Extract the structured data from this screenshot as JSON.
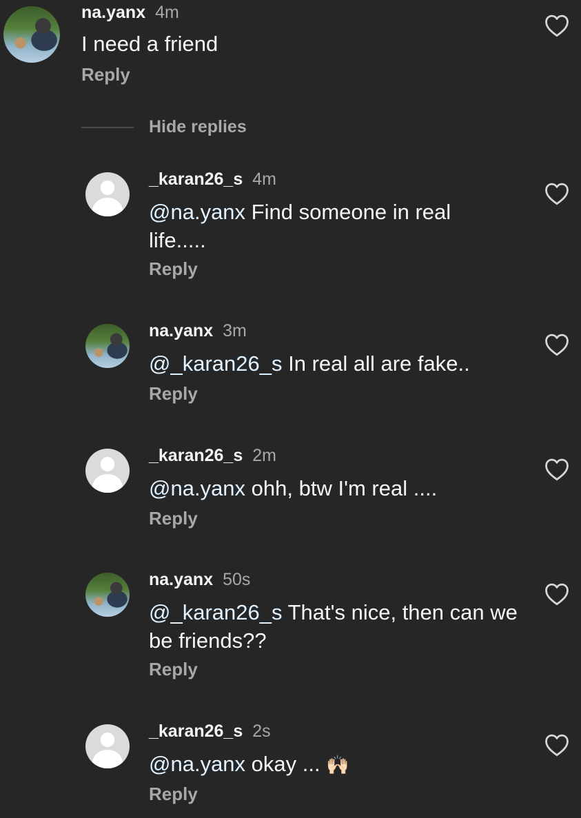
{
  "comments": [
    {
      "username": "na.yanx",
      "time": "4m",
      "mention": "",
      "text": "I need a friend",
      "reply": "Reply",
      "avatar": "photo"
    },
    {
      "username": "_karan26_s",
      "time": "4m",
      "mention": "@na.yanx",
      "text": " Find someone in real life.....",
      "reply": "Reply",
      "avatar": "default"
    },
    {
      "username": "na.yanx",
      "time": "3m",
      "mention": "@_karan26_s",
      "text": " In real all are fake..",
      "reply": "Reply",
      "avatar": "photo"
    },
    {
      "username": "_karan26_s",
      "time": "2m",
      "mention": "@na.yanx",
      "text": " ohh, btw I'm real ....",
      "reply": "Reply",
      "avatar": "default"
    },
    {
      "username": "na.yanx",
      "time": "50s",
      "mention": "@_karan26_s",
      "text": " That's nice, then can we be friends??",
      "reply": "Reply",
      "avatar": "photo"
    },
    {
      "username": "_karan26_s",
      "time": "2s",
      "mention": "@na.yanx",
      "text": " okay ... ",
      "emoji": "🙌🏻",
      "reply": "Reply",
      "avatar": "default"
    }
  ],
  "thread": {
    "hide_replies": "Hide replies"
  },
  "icons": {
    "like": "heart-outline-icon",
    "avatar_default": "default-user-avatar-icon"
  },
  "colors": {
    "background": "#262626",
    "secondary_text": "#a8a8a8",
    "mention": "#e0f1ff"
  }
}
